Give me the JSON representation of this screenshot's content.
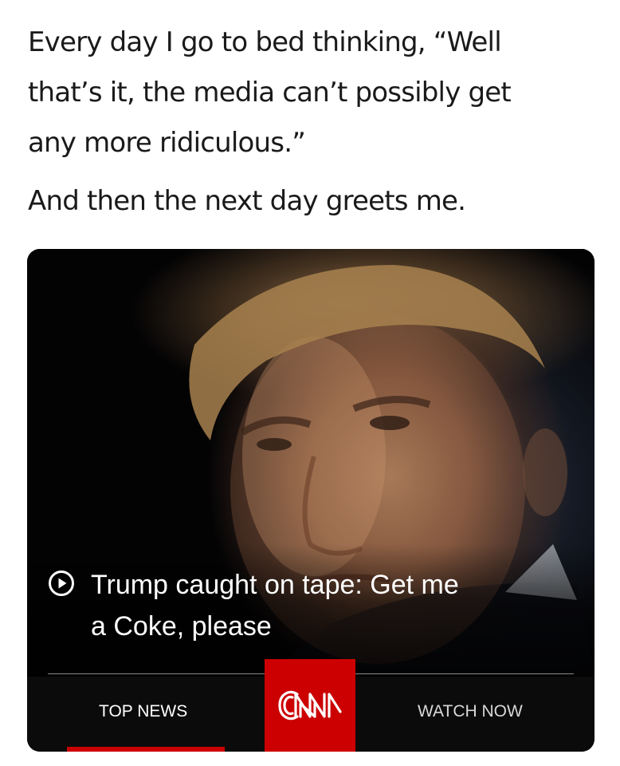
{
  "caption": {
    "line1": "Every day I go to bed thinking, “Well",
    "line2": "that’s it, the media can’t possibly get",
    "line3": "any more ridiculous.”",
    "line4": "And then the next day greets me."
  },
  "card": {
    "photo_icon": "portrait-photo",
    "headline_icon": "play-circle-icon",
    "headline_line1": "Trump caught on tape: Get me",
    "headline_line2": "a Coke, please"
  },
  "navbar": {
    "tabs": [
      {
        "label": "TOP NEWS",
        "active": true
      },
      {
        "label": "WATCH NOW",
        "active": false
      }
    ],
    "logo": "CNN",
    "accent_color": "#cc0000"
  }
}
